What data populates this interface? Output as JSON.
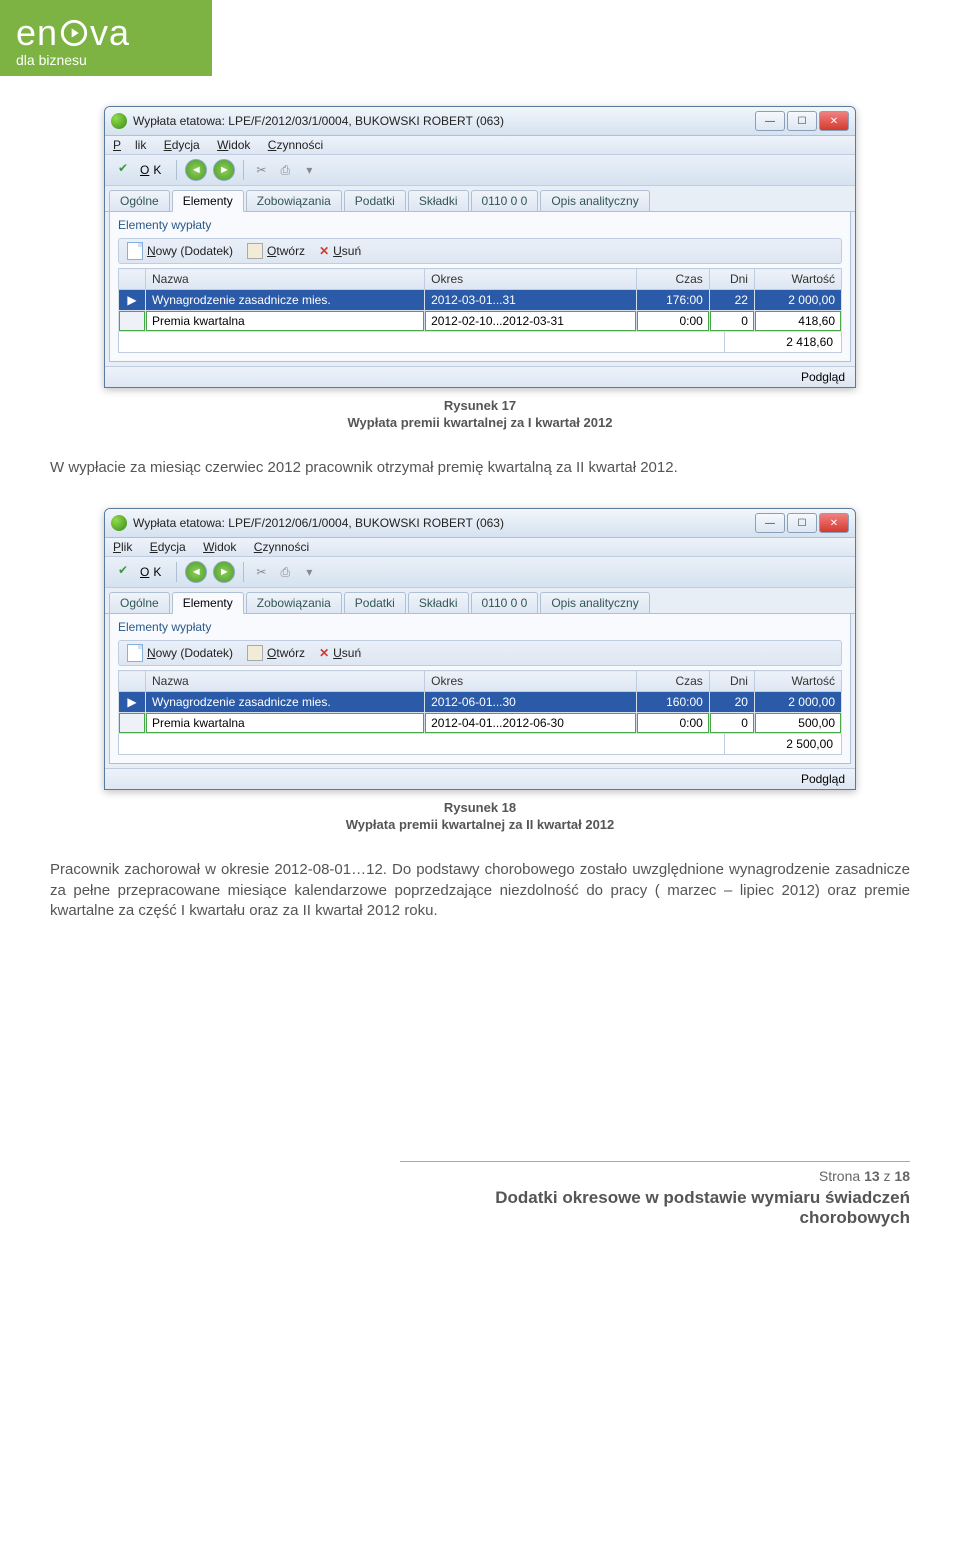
{
  "logo": {
    "brand_text": "en  va",
    "sub": "dla biznesu"
  },
  "window1": {
    "title": "Wypłata etatowa: LPE/F/2012/03/1/0004, BUKOWSKI ROBERT (063)",
    "menu": {
      "plik": "Plik",
      "edycja": "Edycja",
      "widok": "Widok",
      "czynnosci": "Czynności"
    },
    "ok": "OK",
    "tabs": {
      "ogolne": "Ogólne",
      "elementy": "Elementy",
      "zobow": "Zobowiązania",
      "podatki": "Podatki",
      "skladki": "Składki",
      "c0110": "0110 0 0",
      "opis": "Opis analityczny"
    },
    "group": "Elementy wypłaty",
    "panel_tools": {
      "nowy": "Nowy (Dodatek)",
      "otworz": "Otwórz",
      "usun": "Usuń"
    },
    "headers": {
      "nazwa": "Nazwa",
      "okres": "Okres",
      "czas": "Czas",
      "dni": "Dni",
      "wartosc": "Wartość"
    },
    "rows": [
      {
        "marker": "▶",
        "nazwa": "Wynagrodzenie zasadnicze mies.",
        "okres": "2012-03-01...31",
        "czas": "176:00",
        "dni": "22",
        "wartosc": "2 000,00",
        "sel": true
      },
      {
        "marker": "",
        "nazwa": "Premia kwartalna",
        "okres": "2012-02-10...2012-03-31",
        "czas": "0:00",
        "dni": "0",
        "wartosc": "418,60",
        "green": true
      }
    ],
    "total": "2 418,60",
    "podglad": "Podgląd"
  },
  "caption1": {
    "a": "Rysunek 17",
    "b": "Wypłata premii kwartalnej za I kwartał 2012"
  },
  "midtext": "W wypłacie za miesiąc czerwiec 2012 pracownik otrzymał premię kwartalną za II kwartał 2012.",
  "window2": {
    "title": "Wypłata etatowa: LPE/F/2012/06/1/0004, BUKOWSKI ROBERT (063)",
    "menu": {
      "plik": "Plik",
      "edycja": "Edycja",
      "widok": "Widok",
      "czynnosci": "Czynności"
    },
    "ok": "OK",
    "tabs": {
      "ogolne": "Ogólne",
      "elementy": "Elementy",
      "zobow": "Zobowiązania",
      "podatki": "Podatki",
      "skladki": "Składki",
      "c0110": "0110 0 0",
      "opis": "Opis analityczny"
    },
    "group": "Elementy wypłaty",
    "panel_tools": {
      "nowy": "Nowy (Dodatek)",
      "otworz": "Otwórz",
      "usun": "Usuń"
    },
    "headers": {
      "nazwa": "Nazwa",
      "okres": "Okres",
      "czas": "Czas",
      "dni": "Dni",
      "wartosc": "Wartość"
    },
    "rows": [
      {
        "marker": "▶",
        "nazwa": "Wynagrodzenie zasadnicze mies.",
        "okres": "2012-06-01...30",
        "czas": "160:00",
        "dni": "20",
        "wartosc": "2 000,00",
        "sel": true
      },
      {
        "marker": "",
        "nazwa": "Premia kwartalna",
        "okres": "2012-04-01...2012-06-30",
        "czas": "0:00",
        "dni": "0",
        "wartosc": "500,00",
        "green": true
      }
    ],
    "total": "2 500,00",
    "podglad": "Podgląd"
  },
  "caption2": {
    "a": "Rysunek 18",
    "b": "Wypłata premii kwartalnej za II kwartał 2012"
  },
  "bottomtext": "Pracownik zachorował w okresie 2012-08-01…12. Do podstawy chorobowego zostało uwzględnione wynagrodzenie zasadnicze za pełne przepracowane miesiące kalendarzowe poprzedzające niezdolność do pracy ( marzec – lipiec 2012) oraz premie kwartalne za część I kwartału oraz za II kwartał 2012 roku.",
  "footer": {
    "page": "Strona 13 z 18",
    "title1": "Dodatki okresowe w podstawie wymiaru świadczeń",
    "title2": "chorobowych"
  }
}
